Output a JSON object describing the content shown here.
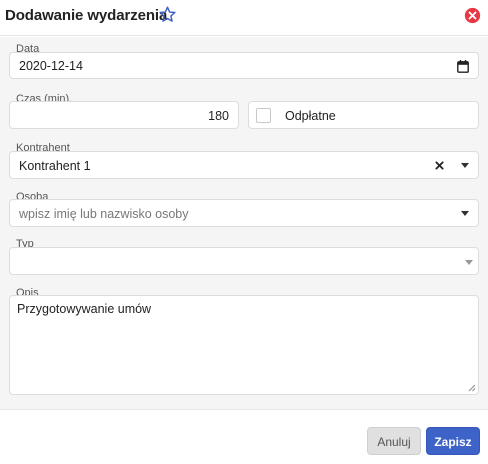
{
  "header": {
    "title": "Dodawanie wydarzenia",
    "star_icon": "star-outline-icon",
    "close_icon": "close-circle-icon",
    "accent_color": "#3d5fc4",
    "close_color": "#e53946"
  },
  "form": {
    "date": {
      "label": "Data",
      "value": "2020-12-14",
      "icon": "calendar-icon"
    },
    "duration": {
      "label": "Czas (min).",
      "value": "180"
    },
    "paid": {
      "label": "Odpłatne",
      "checked": false
    },
    "contractor": {
      "label": "Kontrahent",
      "value": "Kontrahent 1",
      "clear_icon": "clear-x-icon"
    },
    "person": {
      "label": "Osoba",
      "placeholder": "wpisz imię lub nazwisko osoby"
    },
    "type": {
      "label": "Typ",
      "value": ""
    },
    "description": {
      "label": "Opis",
      "value": "Przygotowywanie umów"
    }
  },
  "footer": {
    "cancel_label": "Anuluj",
    "save_label": "Zapisz",
    "save_color": "#3d63c9"
  }
}
